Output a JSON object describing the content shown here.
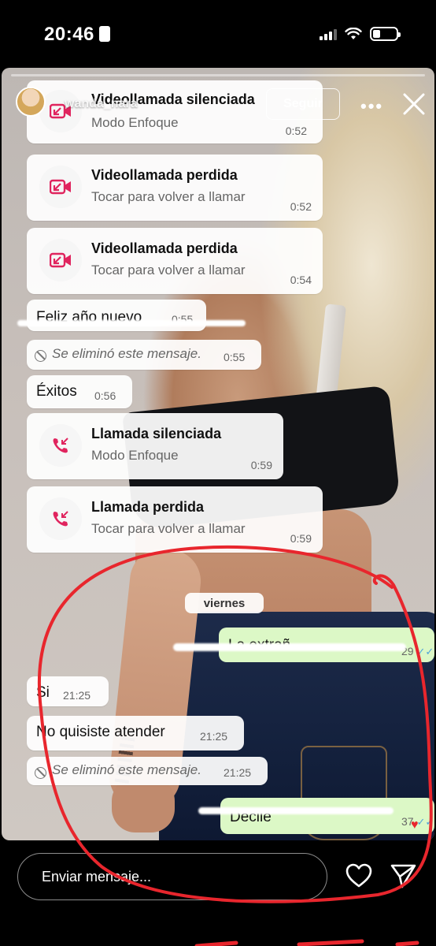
{
  "status_bar": {
    "time": "20:46"
  },
  "story": {
    "username": "wanda_nara",
    "follow_label": "Seguir",
    "more_label": "•••",
    "progress": 1.0
  },
  "chat": {
    "call_cards": [
      {
        "title": "Videollamada silenciada",
        "subtitle": "Modo Enfoque",
        "time": "0:52",
        "icon": "missed-video-call-icon"
      },
      {
        "title": "Videollamada perdida",
        "subtitle": "Tocar para volver a llamar",
        "time": "0:52",
        "icon": "missed-video-call-icon"
      },
      {
        "title": "Videollamada perdida",
        "subtitle": "Tocar para volver a llamar",
        "time": "0:54",
        "icon": "missed-video-call-icon"
      },
      {
        "title": "Llamada silenciada",
        "subtitle": "Modo Enfoque",
        "time": "0:59",
        "icon": "missed-call-icon"
      },
      {
        "title": "Llamada perdida",
        "subtitle": "Tocar para volver a llamar",
        "time": "0:59",
        "icon": "missed-call-icon"
      }
    ],
    "messages": [
      {
        "text": "Feliz año nuevo",
        "time": "0:55"
      },
      {
        "text": "Se eliminó este mensaje.",
        "time": "0:55"
      },
      {
        "text": "Éxitos",
        "time": "0:56"
      },
      {
        "text": "Si",
        "time": "21:25"
      },
      {
        "text": "No quisiste atender",
        "time": "21:25"
      },
      {
        "text": "Se eliminó este mensaje.",
        "time": "21:25"
      }
    ],
    "outgoing": [
      {
        "text": "La extrañ",
        "time": "29"
      },
      {
        "text": "Decile",
        "time": "37"
      }
    ],
    "date_separator": "viernes"
  },
  "reply_bar": {
    "placeholder": "Enviar mensaje..."
  },
  "colors": {
    "annotation": "#e8262d",
    "missed_call": "#e0245e",
    "outgoing_bubble": "#dcf8c6",
    "read_ticks": "#4fa3d9"
  }
}
